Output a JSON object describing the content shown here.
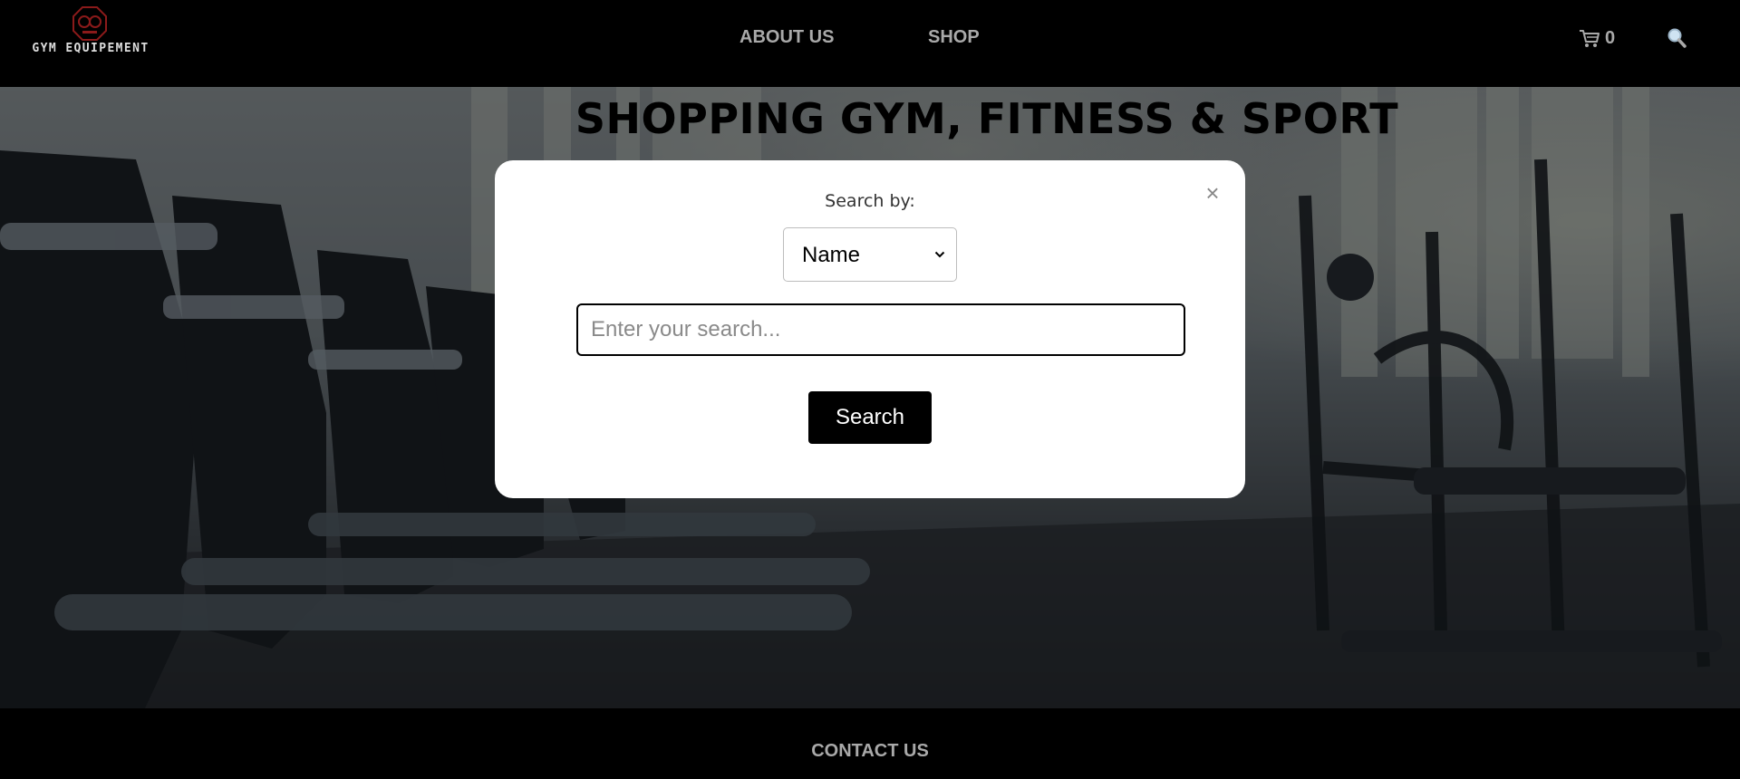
{
  "header": {
    "logo_text": "GYM EQUIPEMENT",
    "nav": [
      {
        "label": "ABOUT US"
      },
      {
        "label": "SHOP"
      }
    ],
    "cart_icon": "cart-icon",
    "cart_count": "0",
    "search_icon": "magnifier-icon"
  },
  "hero": {
    "title": "SHOPPING GYM, FITNESS & SPORT"
  },
  "search_modal": {
    "close_label": "×",
    "search_by_label": "Search by:",
    "search_by_selected": "Name",
    "input_placeholder": "Enter your search...",
    "input_value": "",
    "submit_label": "Search"
  },
  "footer": {
    "contact_label": "CONTACT US"
  },
  "colors": {
    "header_bg": "#000000",
    "nav_text": "#a9a9a9",
    "modal_bg": "#ffffff",
    "button_bg": "#000000",
    "logo_accent": "#8b1a1a"
  }
}
